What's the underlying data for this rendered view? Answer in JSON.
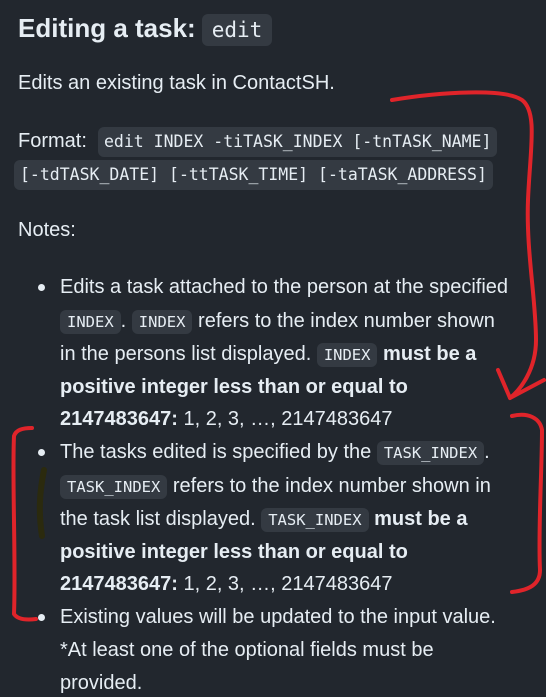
{
  "heading": {
    "title": "Editing a task:",
    "command": "edit"
  },
  "intro": "Edits an existing task in ContactSH.",
  "format": {
    "label": "Format:",
    "line1": "edit INDEX -tiTASK_INDEX [-tnTASK_NAME]",
    "line2": "[-tdTASK_DATE] [-ttTASK_TIME] [-taTASK_ADDRESS]"
  },
  "notes_label": "Notes:",
  "notes": [
    {
      "l1": "Edits a task attached to the person at the specified",
      "code1": "INDEX",
      "dot": ".",
      "code2": "INDEX",
      "l2rest": "refers to the index number shown",
      "l3": "in the persons list displayed.",
      "code3": "INDEX",
      "bold1": "must be a",
      "bold2": "positive integer less than or equal to",
      "bold3": "2147483647:",
      "tail": "1, 2, 3, …, 2147483647"
    },
    {
      "l1": "The tasks edited is specified by the",
      "code1": "TASK_INDEX",
      "dot": ".",
      "code2": "TASK_INDEX",
      "l2rest": "refers to the index number shown in",
      "l3": "the task list displayed.",
      "code3": "TASK_INDEX",
      "bold1": "must be a",
      "bold2": "positive integer less than or equal to",
      "bold3": "2147483647:",
      "tail": "1, 2, 3, …, 2147483647"
    },
    {
      "l1": "Existing values will be updated to the input value.",
      "l2": "*At least one of the optional fields must be",
      "l3": "provided."
    }
  ],
  "annotation_colors": {
    "red": "#e0242a",
    "dark": "#2b2a0e"
  }
}
